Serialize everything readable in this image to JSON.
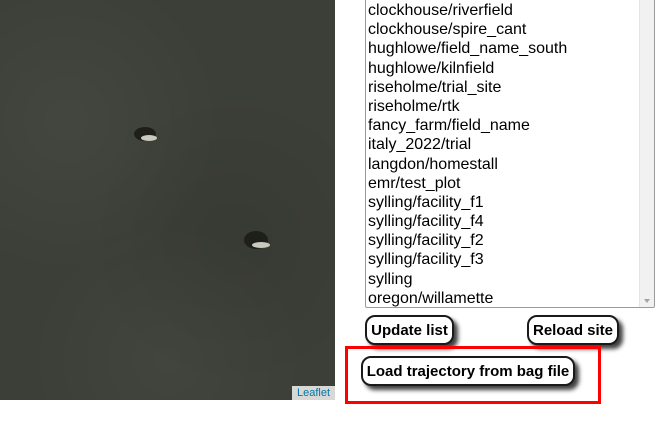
{
  "map": {
    "attribution": "Leaflet"
  },
  "site_list": {
    "items": [
      "clockhouse/riverfield",
      "clockhouse/spire_cant",
      "hughlowe/field_name_south",
      "hughlowe/kilnfield",
      "riseholme/trial_site",
      "riseholme/rtk",
      "fancy_farm/field_name",
      "italy_2022/trial",
      "langdon/homestall",
      "emr/test_plot",
      "sylling/facility_f1",
      "sylling/facility_f4",
      "sylling/facility_f2",
      "sylling/facility_f3",
      "sylling",
      "oregon/willamette"
    ]
  },
  "buttons": {
    "update_list": "Update list",
    "reload_site": "Reload site",
    "load_trajectory": "Load trajectory from bag file"
  },
  "colors": {
    "map_background": "#3c3f37",
    "highlight_border": "#ff0000",
    "leaflet_link": "#0078a8"
  }
}
